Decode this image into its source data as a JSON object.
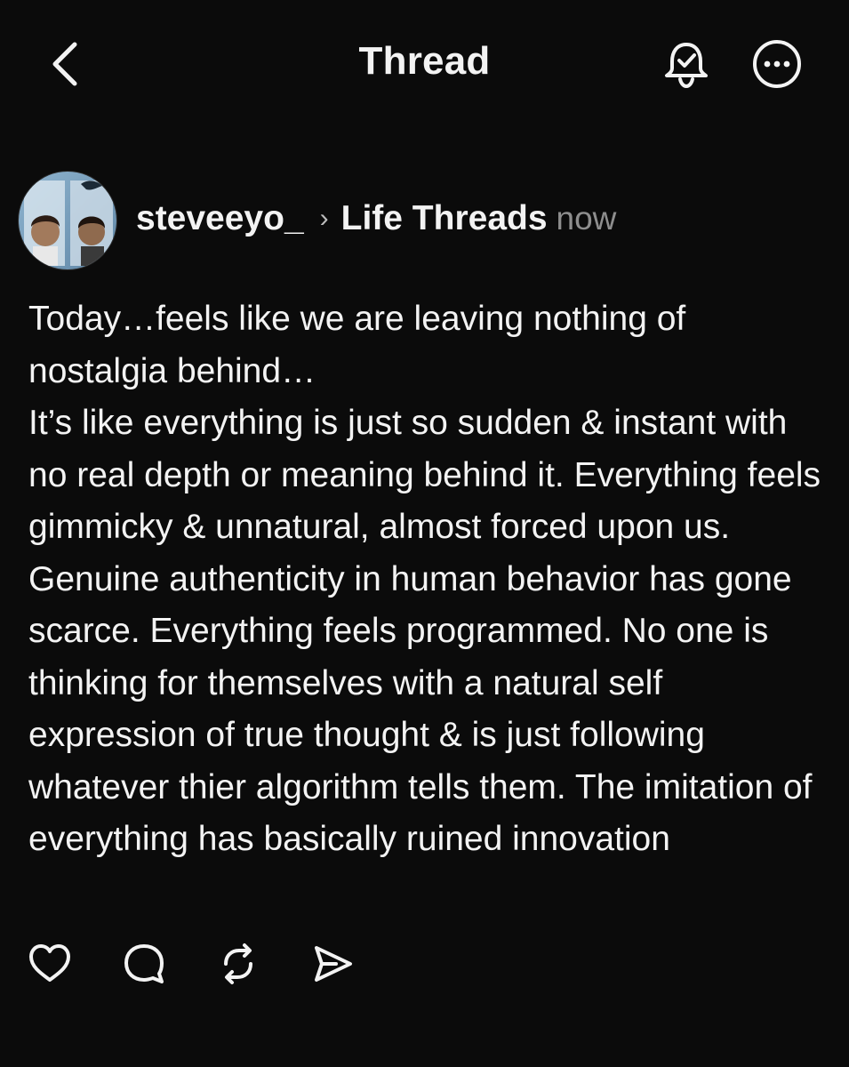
{
  "header": {
    "title": "Thread",
    "icons": {
      "back": "chevron-left-icon",
      "notify": "bell-check-icon",
      "more": "more-horizontal-circle-icon"
    }
  },
  "post": {
    "username": "steveeyo_",
    "community": "Life Threads",
    "timestamp": "now",
    "paragraphs": [
      "Today…feels like we are leaving nothing of nostalgia behind…",
      "It’s like everything is just so sudden & instant with no real depth or meaning behind it. Everything feels gimmicky & unnatural, almost forced upon us.  Genuine authenticity in human behavior has gone scarce.  Everything feels programmed.  No one is thinking for themselves with a natural self expression of true thought & is just following whatever thier algorithm tells them. The imitation of everything has basically ruined innovation"
    ],
    "actions": [
      "heart-icon",
      "comment-icon",
      "repost-icon",
      "share-icon"
    ]
  },
  "colors": {
    "background": "#0b0b0b",
    "text": "#f3f3f3",
    "muted": "#8e8e8e"
  }
}
